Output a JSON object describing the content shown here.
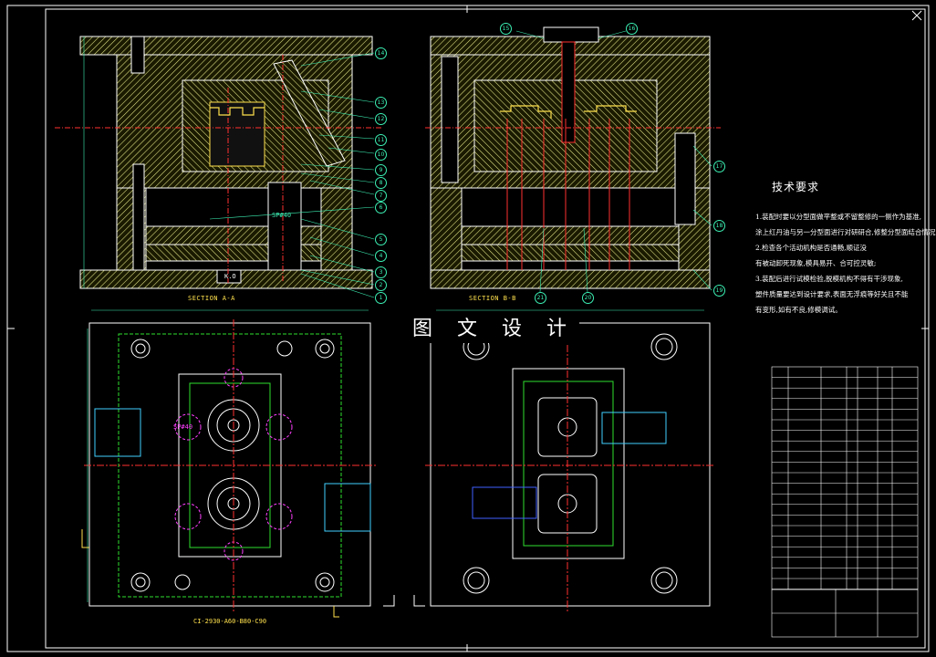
{
  "drawing": {
    "section_a_label": "SECTION A-A",
    "section_b_label": "SECTION B-B",
    "bottom_caption": "CI-2930-A60-B80-C90",
    "watermark": "图 文 设 计",
    "spring_label_1": "SP#40",
    "spring_label_2": "SP#40",
    "ko_label": "K.O"
  },
  "callouts_left": [
    "14",
    "13",
    "12",
    "11",
    "10",
    "9",
    "8",
    "7",
    "6",
    "5",
    "4",
    "3",
    "2",
    "1"
  ],
  "callouts_right": [
    "15",
    "16",
    "17",
    "18",
    "19",
    "21",
    "20"
  ],
  "tech_requirements": {
    "title": "技术要求",
    "lines": [
      "1.装配时要以分型面做平整或不留整修的一侧作为基准,",
      "涂上红丹油与另一分型面进行对研研合,修整分型面结合情况;",
      "2.检查各个活动机构是否通畅,顺证没",
      "有被动卸死现象,模具易开、合可控灵敏;",
      "3.装配后进行试模检验,脱模机构不得有干涉现象,",
      "塑件质量要达到设计要求,表面无浮痕等好关且不能",
      "有变形,如有不良,修模调试。"
    ]
  },
  "colors": {
    "background": "#000000",
    "hatch": "#e6e88a",
    "outline": "#ffffff",
    "centerline": "#ff3030",
    "dimension": "#3cf0b4",
    "hidden": "#2ee02e",
    "magenta": "#ff40ff",
    "cyan": "#40d0ff",
    "blue": "#4060ff",
    "text_yellow": "#ffe14d"
  }
}
